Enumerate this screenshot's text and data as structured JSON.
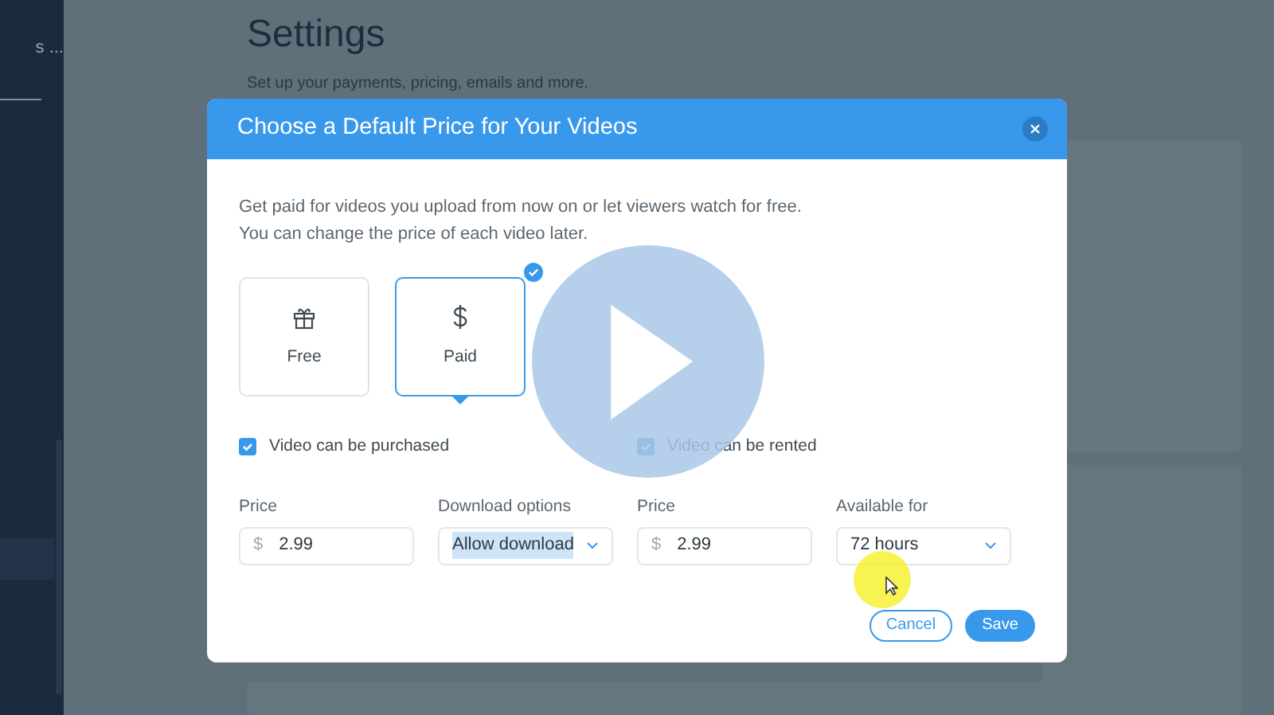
{
  "sidebar": {
    "title": "s ..."
  },
  "page": {
    "title": "Settings",
    "subtitle": "Set up your payments, pricing, emails and more."
  },
  "dialog": {
    "title": "Choose a Default Price for Your Videos",
    "description_lines": [
      "Get paid for videos you upload from now on or let viewers watch for free.",
      "You can change the price of each video later."
    ],
    "price_options": [
      {
        "label": "Free",
        "kind": "gift",
        "selected": false
      },
      {
        "label": "Paid",
        "kind": "dollar",
        "selected": true
      }
    ],
    "checkboxes": [
      {
        "label": "Video can be purchased",
        "checked": true
      },
      {
        "label": "Video can be rented",
        "checked": true
      }
    ],
    "fields": [
      {
        "label": "Price",
        "kind": "price",
        "prefix": "$",
        "value": "2.99"
      },
      {
        "label": "Download options",
        "kind": "select",
        "value": "Allow download",
        "text_selected": true
      },
      {
        "label": "Price",
        "kind": "price",
        "prefix": "$",
        "value": "2.99"
      },
      {
        "label": "Available for",
        "kind": "select",
        "value": "72 hours",
        "text_selected": false
      }
    ],
    "buttons": [
      {
        "label": "Cancel",
        "kind": "secondary"
      },
      {
        "label": "Save",
        "kind": "primary"
      }
    ]
  },
  "player": {
    "play_button": true,
    "cursor_highlight": true
  }
}
